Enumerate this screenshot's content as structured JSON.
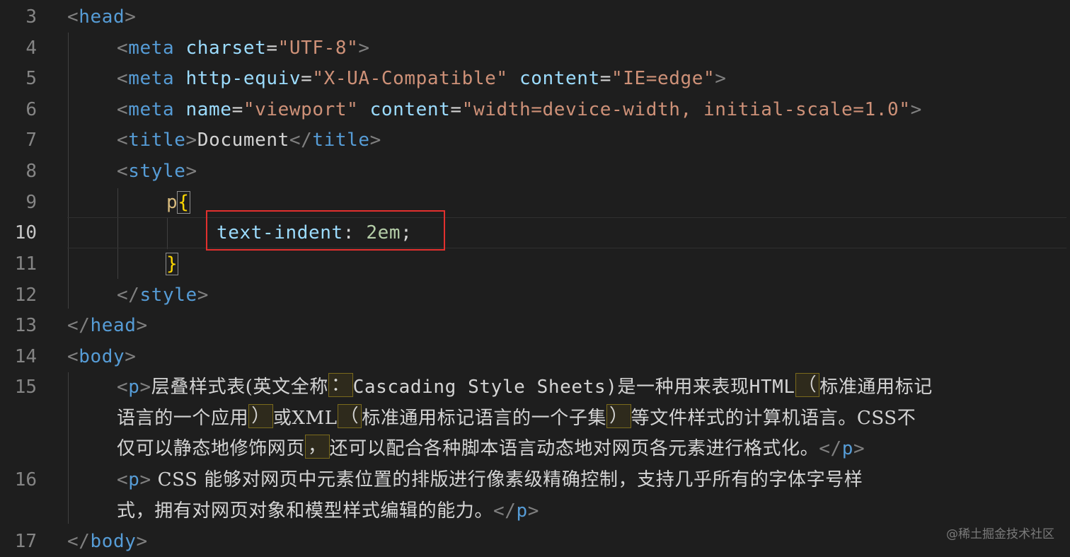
{
  "editor": {
    "line_numbers": [
      "3",
      "4",
      "5",
      "6",
      "7",
      "8",
      "9",
      "10",
      "11",
      "12",
      "13",
      "14",
      "15",
      "16",
      "17"
    ],
    "active_line": "10",
    "lines": {
      "l3": {
        "open": "<",
        "tag": "head",
        "close": ">"
      },
      "l4": {
        "open": "<",
        "tag": "meta",
        "attr": "charset",
        "eq": "=",
        "val": "\"UTF-8\"",
        "close": ">"
      },
      "l5": {
        "open": "<",
        "tag": "meta",
        "attr1": "http-equiv",
        "eq1": "=",
        "val1": "\"X-UA-Compatible\"",
        "attr2": "content",
        "eq2": "=",
        "val2": "\"IE=edge\"",
        "close": ">"
      },
      "l6": {
        "open": "<",
        "tag": "meta",
        "attr1": "name",
        "eq1": "=",
        "val1": "\"viewport\"",
        "attr2": "content",
        "eq2": "=",
        "val2": "\"width=device-width, initial-scale=1.0\"",
        "close": ">"
      },
      "l7": {
        "open": "<",
        "tag": "title",
        "close": ">",
        "text": "Document",
        "end_open": "</",
        "end_tag": "title",
        "end_close": ">"
      },
      "l8": {
        "open": "<",
        "tag": "style",
        "close": ">"
      },
      "l9": {
        "selector": "p",
        "brace": "{"
      },
      "l10": {
        "property": "text-indent",
        "colon": ": ",
        "value": "2em",
        "semi": ";"
      },
      "l11": {
        "brace": "}"
      },
      "l12": {
        "open": "</",
        "tag": "style",
        "close": ">"
      },
      "l13": {
        "open": "</",
        "tag": "head",
        "close": ">"
      },
      "l14": {
        "open": "<",
        "tag": "body",
        "close": ">"
      },
      "l15": {
        "open": "<",
        "tag": "p",
        "close": ">",
        "row1_a": "层叠样式表(英文全称",
        "row1_flag": "：",
        "row1_b": "Cascading Style Sheets)是一种用来表现HTML",
        "row1_flag2": "（",
        "row1_c": "标准通用标记",
        "row2_a": "语言的一个应用",
        "row2_flag": "）",
        "row2_b": "或XML",
        "row2_flag2": "（",
        "row2_c": "标准通用标记语言的一个子集",
        "row2_flag3": "）",
        "row2_d": "等文件样式的计算机语言。CSS不",
        "row3_a": "仅可以静态地修饰网页",
        "row3_flag": "，",
        "row3_b": "还可以配合各种脚本语言动态地对网页各元素进行格式化。",
        "end_open": "</",
        "end_tag": "p",
        "end_close": ">"
      },
      "l16": {
        "open": "<",
        "tag": "p",
        "close": ">",
        "row1": " CSS 能够对网页中元素位置的排版进行像素级精确控制，支持几乎所有的字体字号样",
        "row2": "式，拥有对网页对象和模型样式编辑的能力。",
        "end_open": "</",
        "end_tag": "p",
        "end_close": ">"
      },
      "l17": {
        "open": "</",
        "tag": "body",
        "close": ">"
      }
    }
  },
  "watermark": "@稀土掘金技术社区",
  "colors": {
    "background": "#1e1e1e",
    "tag": "#569cd6",
    "attribute": "#9cdcfe",
    "string": "#ce9178",
    "text": "#d4d4d4",
    "selector": "#d7ba7d",
    "brace": "#ffd700",
    "number": "#b5cea8",
    "highlight_box": "#e2302e"
  }
}
